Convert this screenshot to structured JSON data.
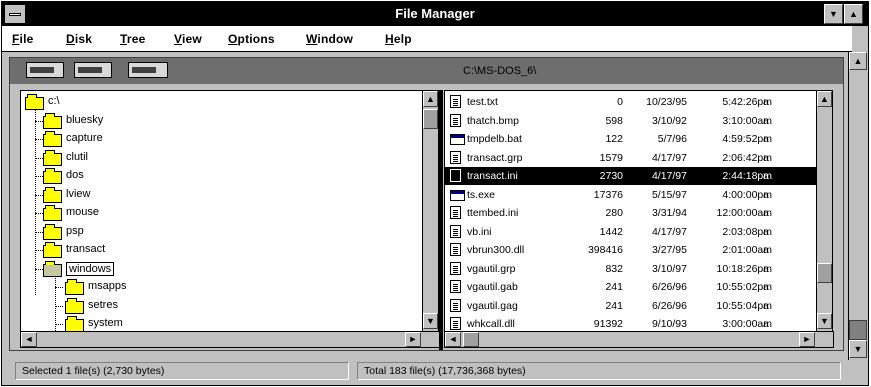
{
  "app": {
    "title": "File Manager"
  },
  "menu": [
    {
      "underline": "F",
      "rest": "ile"
    },
    {
      "underline": "D",
      "rest": "isk"
    },
    {
      "underline": "T",
      "rest": "ree"
    },
    {
      "underline": "V",
      "rest": "iew"
    },
    {
      "underline": "O",
      "rest": "ptions"
    },
    {
      "underline": "W",
      "rest": "indow"
    },
    {
      "underline": "H",
      "rest": "elp"
    }
  ],
  "child": {
    "path": "C:\\MS-DOS_6\\"
  },
  "tree": [
    {
      "label": "c:\\"
    },
    {
      "label": "bluesky"
    },
    {
      "label": "capture"
    },
    {
      "label": "clutil"
    },
    {
      "label": "dos"
    },
    {
      "label": "lview"
    },
    {
      "label": "mouse"
    },
    {
      "label": "psp"
    },
    {
      "label": "transact"
    },
    {
      "label": "windows"
    },
    {
      "label": "msapps"
    },
    {
      "label": "setres"
    },
    {
      "label": "system"
    }
  ],
  "files": [
    {
      "name": "test.txt",
      "size": "0",
      "date": "10/23/95",
      "time": "5:42:26pm",
      "attr": "a",
      "icon": "doc"
    },
    {
      "name": "thatch.bmp",
      "size": "598",
      "date": "3/10/92",
      "time": "3:10:00am",
      "attr": "a",
      "icon": "doc"
    },
    {
      "name": "tmpdelb.bat",
      "size": "122",
      "date": "5/7/96",
      "time": "4:59:52pm",
      "attr": "a",
      "icon": "exe"
    },
    {
      "name": "transact.grp",
      "size": "1579",
      "date": "4/17/97",
      "time": "2:06:42pm",
      "attr": "a",
      "icon": "doc"
    },
    {
      "name": "transact.ini",
      "size": "2730",
      "date": "4/17/97",
      "time": "2:44:18pm",
      "attr": "a",
      "icon": "doc"
    },
    {
      "name": "ts.exe",
      "size": "17376",
      "date": "5/15/97",
      "time": "4:00:00pm",
      "attr": "a",
      "icon": "exe"
    },
    {
      "name": "ttembed.ini",
      "size": "280",
      "date": "3/31/94",
      "time": "12:00:00am",
      "attr": "a",
      "icon": "doc"
    },
    {
      "name": "vb.ini",
      "size": "1442",
      "date": "4/17/97",
      "time": "2:03:08pm",
      "attr": "a",
      "icon": "doc"
    },
    {
      "name": "vbrun300.dll",
      "size": "398416",
      "date": "3/27/95",
      "time": "2:01:00am",
      "attr": "a",
      "icon": "doc"
    },
    {
      "name": "vgautil.grp",
      "size": "832",
      "date": "3/10/97",
      "time": "10:18:26pm",
      "attr": "a",
      "icon": "doc"
    },
    {
      "name": "vgautil.gab",
      "size": "241",
      "date": "6/26/96",
      "time": "10:55:02pm",
      "attr": "a",
      "icon": "doc"
    },
    {
      "name": "vgautil.gag",
      "size": "241",
      "date": "6/26/96",
      "time": "10:55:04pm",
      "attr": "a",
      "icon": "doc"
    },
    {
      "name": "whkcall.dll",
      "size": "91392",
      "date": "9/10/93",
      "time": "3:00:00am",
      "attr": "a",
      "icon": "doc"
    }
  ],
  "selected_file_index": 4,
  "status": {
    "selected": "Selected 1 file(s) (2,730 bytes)",
    "total": "Total 183 file(s) (17,736,368 bytes)"
  }
}
